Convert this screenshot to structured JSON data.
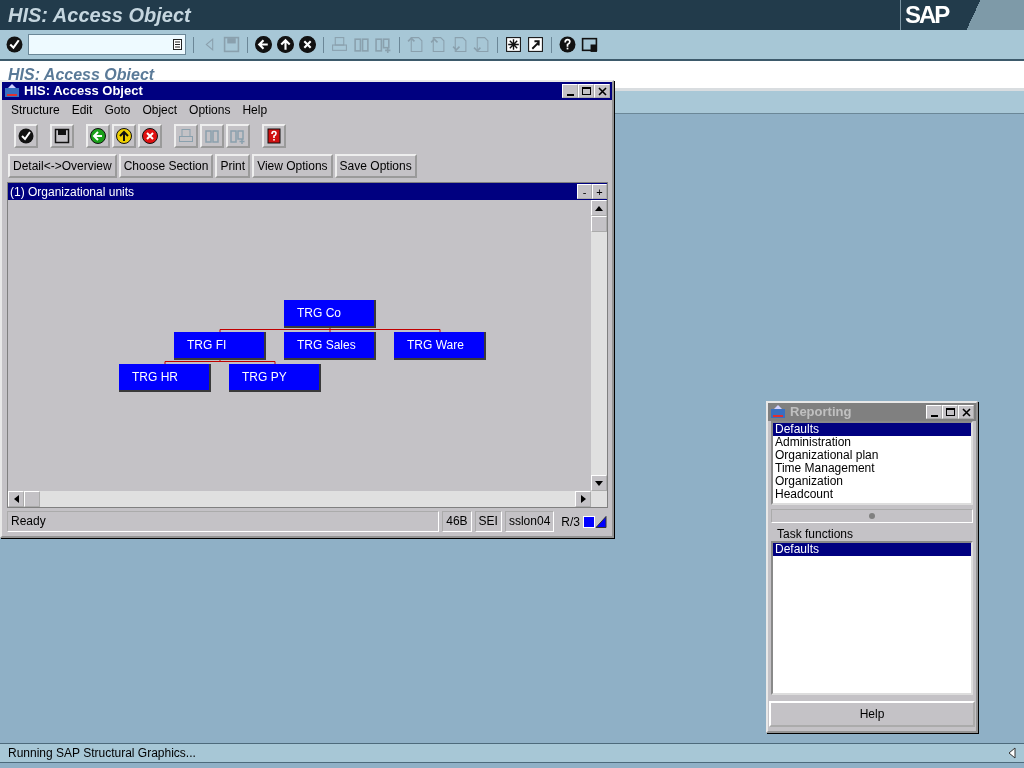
{
  "app_title": "HIS: Access Object",
  "logo": "SAP",
  "toolbar": [
    {
      "kind": "enter",
      "disabled": false
    },
    {
      "kind": "field"
    },
    {
      "kind": "sep"
    },
    {
      "kind": "tri-left",
      "disabled": true
    },
    {
      "kind": "save",
      "disabled": true
    },
    {
      "kind": "sep"
    },
    {
      "kind": "back",
      "disabled": false
    },
    {
      "kind": "exit",
      "disabled": false
    },
    {
      "kind": "cancel",
      "disabled": false
    },
    {
      "kind": "sep"
    },
    {
      "kind": "print",
      "disabled": true
    },
    {
      "kind": "find",
      "disabled": true
    },
    {
      "kind": "find-next",
      "disabled": true
    },
    {
      "kind": "sep"
    },
    {
      "kind": "page-first",
      "disabled": true
    },
    {
      "kind": "page-prev",
      "disabled": true
    },
    {
      "kind": "page-next",
      "disabled": true
    },
    {
      "kind": "page-last",
      "disabled": true
    },
    {
      "kind": "sep"
    },
    {
      "kind": "session",
      "disabled": false
    },
    {
      "kind": "shortcut",
      "disabled": false
    },
    {
      "kind": "sep"
    },
    {
      "kind": "help",
      "disabled": false
    },
    {
      "kind": "layout",
      "disabled": false
    }
  ],
  "page_title": "HIS: Access Object",
  "window": {
    "title": "HIS: Access Object",
    "menu": [
      "Structure",
      "Edit",
      "Goto",
      "Object",
      "Options",
      "Help"
    ],
    "tools": [
      {
        "kind": "enter",
        "disabled": false
      },
      {
        "kind": "gap"
      },
      {
        "kind": "save",
        "disabled": false
      },
      {
        "kind": "gap"
      },
      {
        "kind": "back",
        "disabled": false
      },
      {
        "kind": "exit",
        "disabled": false
      },
      {
        "kind": "cancel",
        "disabled": false
      },
      {
        "kind": "gap"
      },
      {
        "kind": "print",
        "disabled": true
      },
      {
        "kind": "find",
        "disabled": true
      },
      {
        "kind": "find-next",
        "disabled": true
      },
      {
        "kind": "gap"
      },
      {
        "kind": "help",
        "disabled": false
      }
    ],
    "buttons": [
      "Detail<->Overview",
      "Choose Section",
      "Print",
      "View Options",
      "Save Options"
    ],
    "pane_title": "(1) Organizational units",
    "pane_controls": [
      "-",
      "+"
    ],
    "tree": {
      "label": "TRG Co",
      "children": [
        {
          "label": "TRG FI",
          "children": [
            {
              "label": "TRG HR"
            },
            {
              "label": "TRG PY"
            }
          ]
        },
        {
          "label": "TRG Sales"
        },
        {
          "label": "TRG Ware"
        }
      ]
    },
    "status": {
      "message": "Ready",
      "fields": [
        "46B",
        "SEI",
        "sslon04"
      ],
      "system": "R/3"
    }
  },
  "reporting": {
    "title": "Reporting",
    "active": false,
    "items": [
      {
        "label": "Defaults",
        "selected": true
      },
      {
        "label": "Administration",
        "selected": false
      },
      {
        "label": "Organizational plan",
        "selected": false
      },
      {
        "label": "Time Management",
        "selected": false
      },
      {
        "label": "Organization",
        "selected": false
      },
      {
        "label": "Headcount",
        "selected": false
      }
    ],
    "task_label": "Task functions",
    "tasks": [
      {
        "label": "Defaults",
        "selected": true
      }
    ],
    "button": "Help"
  },
  "status_bar": "Running SAP Structural Graphics..."
}
